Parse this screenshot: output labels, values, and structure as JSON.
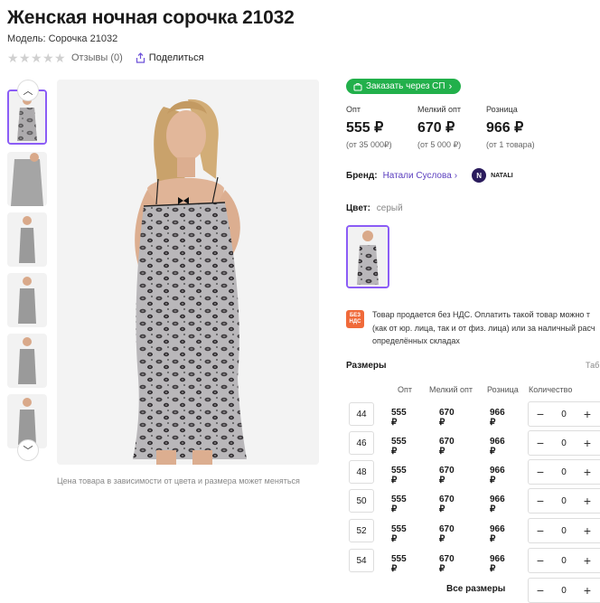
{
  "product": {
    "title": "Женская ночная сорочка 21032",
    "model": "Модель: Сорочка 21032",
    "reviews": "Отзывы (0)",
    "share": "Поделиться",
    "image_caption": "Цена товара в зависимости от цвета и размера может меняться"
  },
  "sp_button": "Заказать через СП",
  "prices": [
    {
      "label": "Опт",
      "value": "555 ₽",
      "note": "(от 35 000₽)"
    },
    {
      "label": "Мелкий опт",
      "value": "670 ₽",
      "note": "(от 5 000 ₽)"
    },
    {
      "label": "Розница",
      "value": "966 ₽",
      "note": "(от 1 товара)"
    }
  ],
  "brand": {
    "label": "Бренд:",
    "name": "Натали Суслова",
    "logo_text": "NATALI"
  },
  "color": {
    "label": "Цвет:",
    "value": "серый"
  },
  "vat": {
    "badge": "БЕЗ НДС",
    "line1": "Товар продается без НДС. Оплатить такой товар можно т",
    "line2": "(как от юр. лица, так и от физ. лица) или за наличный расч",
    "line3": "определённых складах"
  },
  "sizes": {
    "title": "Размеры",
    "table_link": "Таб",
    "headers": [
      "Опт",
      "Мелкий опт",
      "Розница",
      "Количество"
    ],
    "rows": [
      {
        "size": "44",
        "opt": "555 ₽",
        "small_opt": "670 ₽",
        "retail": "966 ₽",
        "qty": "0"
      },
      {
        "size": "46",
        "opt": "555 ₽",
        "small_opt": "670 ₽",
        "retail": "966 ₽",
        "qty": "0"
      },
      {
        "size": "48",
        "opt": "555 ₽",
        "small_opt": "670 ₽",
        "retail": "966 ₽",
        "qty": "0"
      },
      {
        "size": "50",
        "opt": "555 ₽",
        "small_opt": "670 ₽",
        "retail": "966 ₽",
        "qty": "0"
      },
      {
        "size": "52",
        "opt": "555 ₽",
        "small_opt": "670 ₽",
        "retail": "966 ₽",
        "qty": "0"
      },
      {
        "size": "54",
        "opt": "555 ₽",
        "small_opt": "670 ₽",
        "retail": "966 ₽",
        "qty": "0"
      }
    ],
    "all_sizes": "Все размеры",
    "all_qty": "0"
  },
  "colors": {
    "accent": "#8b5cf6",
    "green": "#22b04b",
    "brand_link": "#5b3fbf",
    "vat_badge": "#f06a3a"
  }
}
